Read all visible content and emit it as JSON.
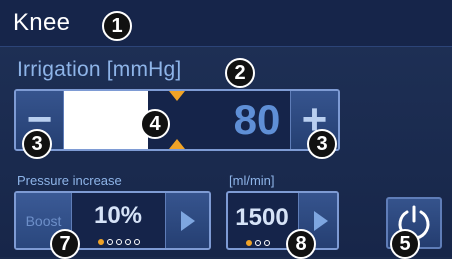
{
  "header": {
    "title": "Knee",
    "callout": "1"
  },
  "irrigation": {
    "title": "Irrigation [mmHg]",
    "title_callout": "2",
    "minus_label": "−",
    "plus_label": "+",
    "value": "80",
    "slider_callout": "4",
    "minus_callout": "3",
    "plus_callout": "3"
  },
  "pressure_increase": {
    "label": "Pressure increase",
    "boost_label": "Boost",
    "value": "10%",
    "callout": "7",
    "steps_total": 5,
    "steps_active": 1
  },
  "flow": {
    "label": "[ml/min]",
    "value": "1500",
    "callout": "8",
    "steps_total": 3,
    "steps_active": 1
  },
  "power": {
    "callout": "5"
  },
  "colors": {
    "background": "#1b2a4c",
    "accent": "#f0a326",
    "value_blue": "#5f8fd6",
    "border": "#7e9bd4"
  },
  "icons": [
    "minus-icon",
    "plus-icon",
    "play-arrow-icon",
    "power-icon",
    "slider-marker-icon"
  ]
}
